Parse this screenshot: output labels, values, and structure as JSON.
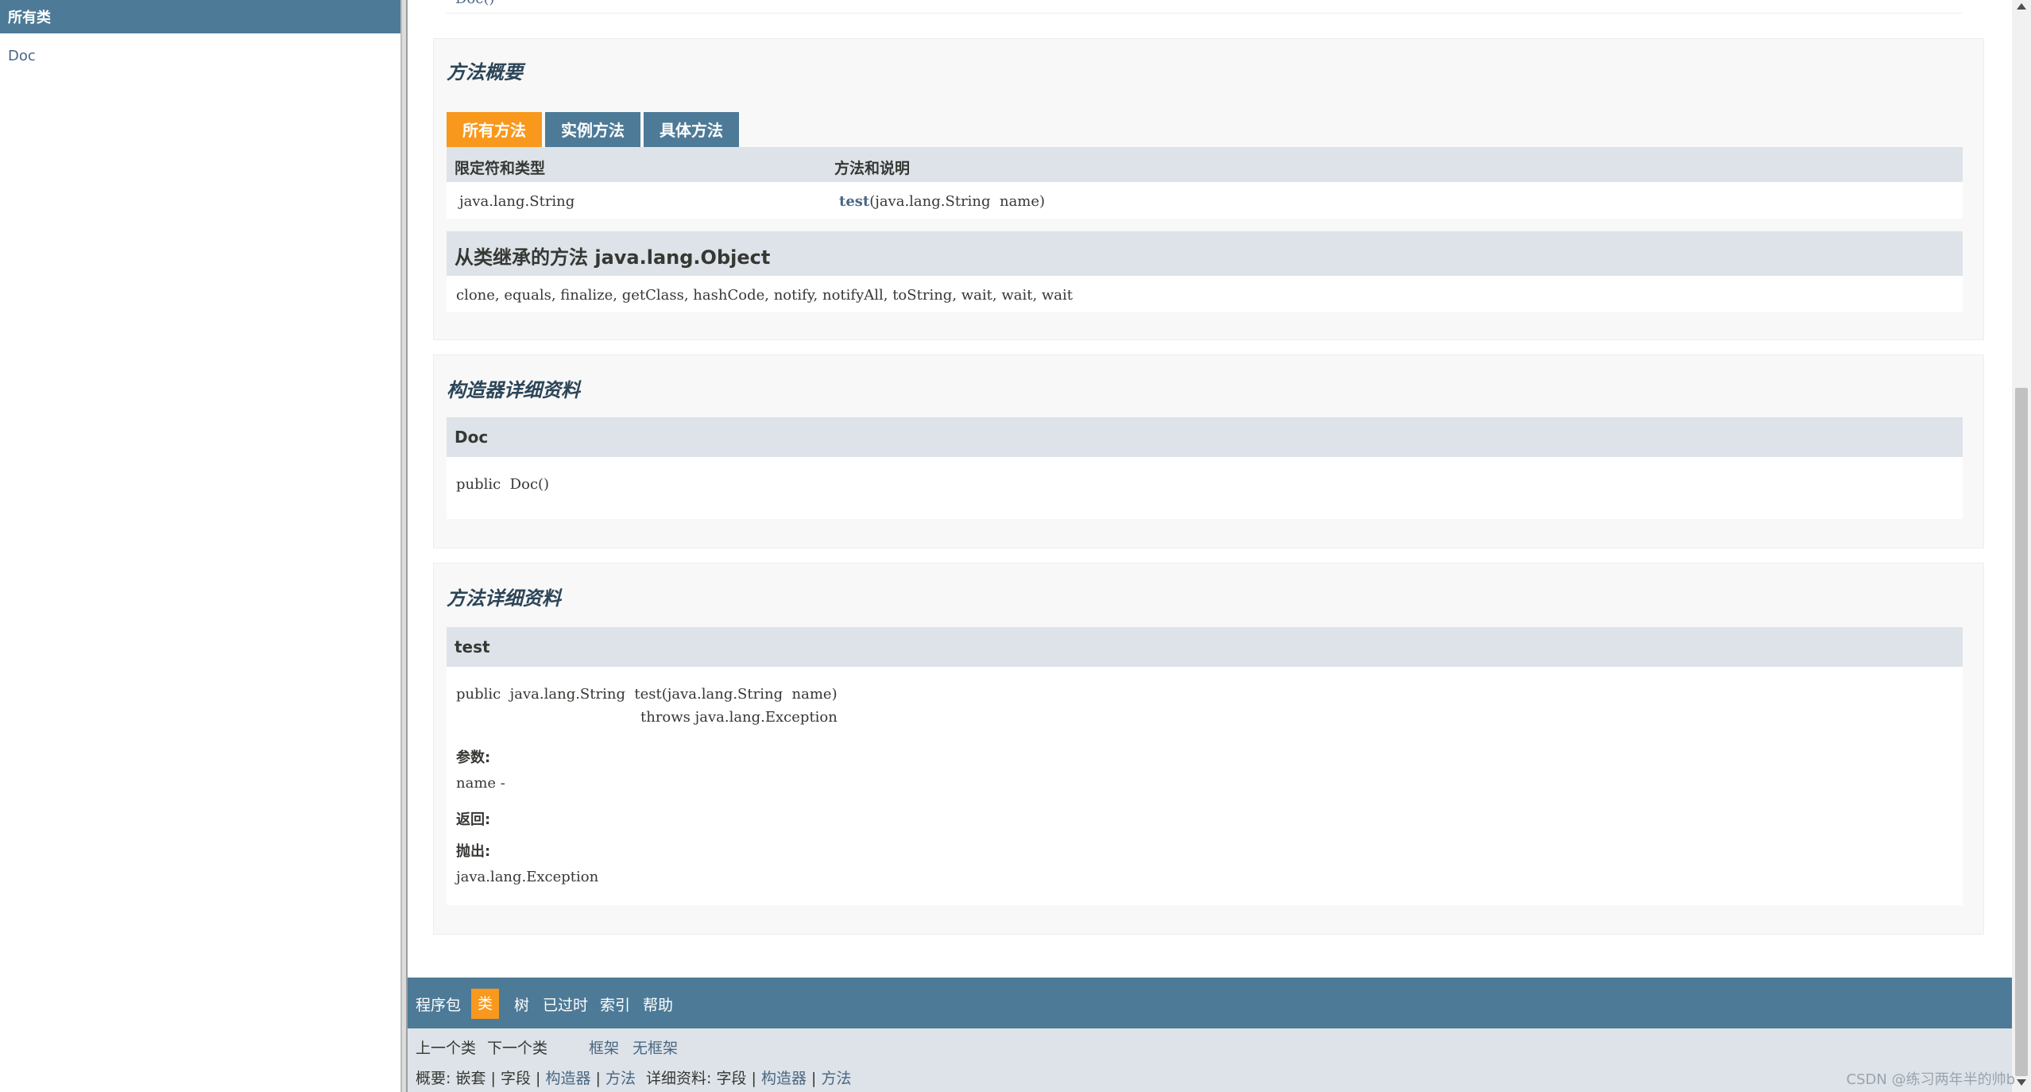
{
  "left": {
    "header": "所有类",
    "class_link": "Doc"
  },
  "top_strip": {
    "text": "Doc()"
  },
  "method_summary": {
    "title": "方法概要",
    "tabs": [
      {
        "label": "所有方法",
        "active": true
      },
      {
        "label": "实例方法",
        "active": false
      },
      {
        "label": "具体方法",
        "active": false
      }
    ],
    "columns": [
      "限定符和类型",
      "方法和说明"
    ],
    "rows": [
      {
        "type": "java.lang.String",
        "method": "test",
        "params": "(java.lang.String  name)"
      }
    ],
    "inherited_title": "从类继承的方法 java.lang.Object",
    "inherited_methods": "clone, equals, finalize, getClass, hashCode, notify, notifyAll, toString, wait, wait, wait"
  },
  "constructor_detail": {
    "title": "构造器详细资料",
    "name": "Doc",
    "signature": "public  Doc()"
  },
  "method_detail": {
    "title": "方法详细资料",
    "name": "test",
    "signature_line1": "public  java.lang.String  test(java.lang.String  name)",
    "signature_line2": "throws java.lang.Exception",
    "params_label": "参数:",
    "params_value": "name -",
    "returns_label": "返回:",
    "throws_label": "抛出:",
    "throws_value": "java.lang.Exception"
  },
  "bottom_nav": {
    "items": [
      "程序包",
      "类",
      "树",
      "已过时",
      "索引",
      "帮助"
    ],
    "active": "类",
    "prev_class": "上一个类",
    "next_class": "下一个类",
    "frames": "框架",
    "no_frames": "无框架",
    "summary_label": "概要:",
    "summary_nested": "嵌套",
    "summary_field": "字段",
    "summary_constructor": "构造器",
    "summary_method": "方法",
    "detail_label": "详细资料:",
    "detail_field": "字段",
    "detail_constructor": "构造器",
    "detail_method": "方法",
    "separator": "|"
  },
  "watermark": "CSDN @练习两年半的帅b",
  "colors": {
    "header_blue": "#4d7a97",
    "tab_orange": "#f8981d",
    "bar_gray": "#dee3e9",
    "link": "#4a6782"
  }
}
